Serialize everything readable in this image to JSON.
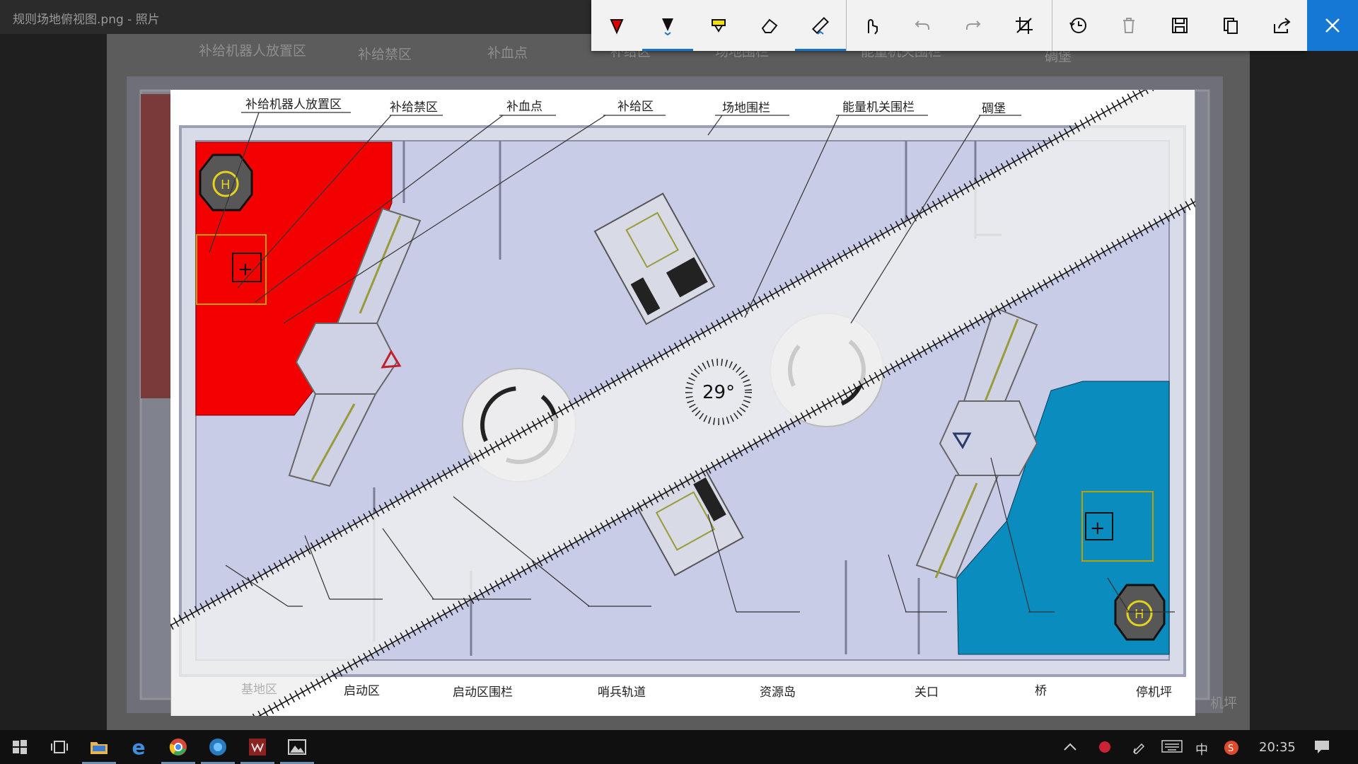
{
  "window": {
    "title": "规则场地俯视图.png - 照片"
  },
  "toolbar": {
    "buttons": [
      {
        "name": "ballpoint-pen",
        "label": "圆珠笔"
      },
      {
        "name": "pencil",
        "label": "铅笔"
      },
      {
        "name": "highlighter",
        "label": "荧光笔"
      },
      {
        "name": "eraser",
        "label": "橡皮擦"
      },
      {
        "name": "ruler",
        "label": "标尺"
      },
      {
        "name": "touch-writing",
        "label": "触摸书写"
      },
      {
        "name": "undo",
        "label": "撤消"
      },
      {
        "name": "redo",
        "label": "重做"
      },
      {
        "name": "crop",
        "label": "裁剪"
      },
      {
        "name": "restore",
        "label": "还原"
      },
      {
        "name": "delete",
        "label": "删除"
      },
      {
        "name": "save",
        "label": "保存"
      },
      {
        "name": "copy",
        "label": "复制"
      },
      {
        "name": "share",
        "label": "共享"
      }
    ],
    "selected": [
      "pencil",
      "ruler"
    ],
    "accent": "#1478d4"
  },
  "map": {
    "labels_top": [
      "补给机器人放置区",
      "补给禁区",
      "补血点",
      "补给区",
      "场地围栏",
      "能量机关围栏",
      "碉堡"
    ],
    "labels_bottom": [
      "基地区",
      "启动区",
      "启动区围栏",
      "哨兵轨道",
      "资源岛",
      "关口",
      "桥",
      "停机坪"
    ],
    "background_labels_top": [
      "补给机器人放置区",
      "补给禁区",
      "补血点",
      "补给区",
      "场地围栏",
      "能量机关围栏",
      "碉堡"
    ],
    "background_label_bottom_right": "机坪",
    "colors": {
      "red_zone": "#f30000",
      "blue_zone": "#0a8cbf",
      "field": "#c8cce6"
    }
  },
  "ruler": {
    "angle": "29°"
  },
  "taskbar": {
    "apps": [
      "start",
      "task-view",
      "file-explorer",
      "internet-explorer",
      "chrome",
      "app-m",
      "app-wps",
      "photos"
    ],
    "tray": {
      "input": "中",
      "time": "20:35"
    }
  }
}
